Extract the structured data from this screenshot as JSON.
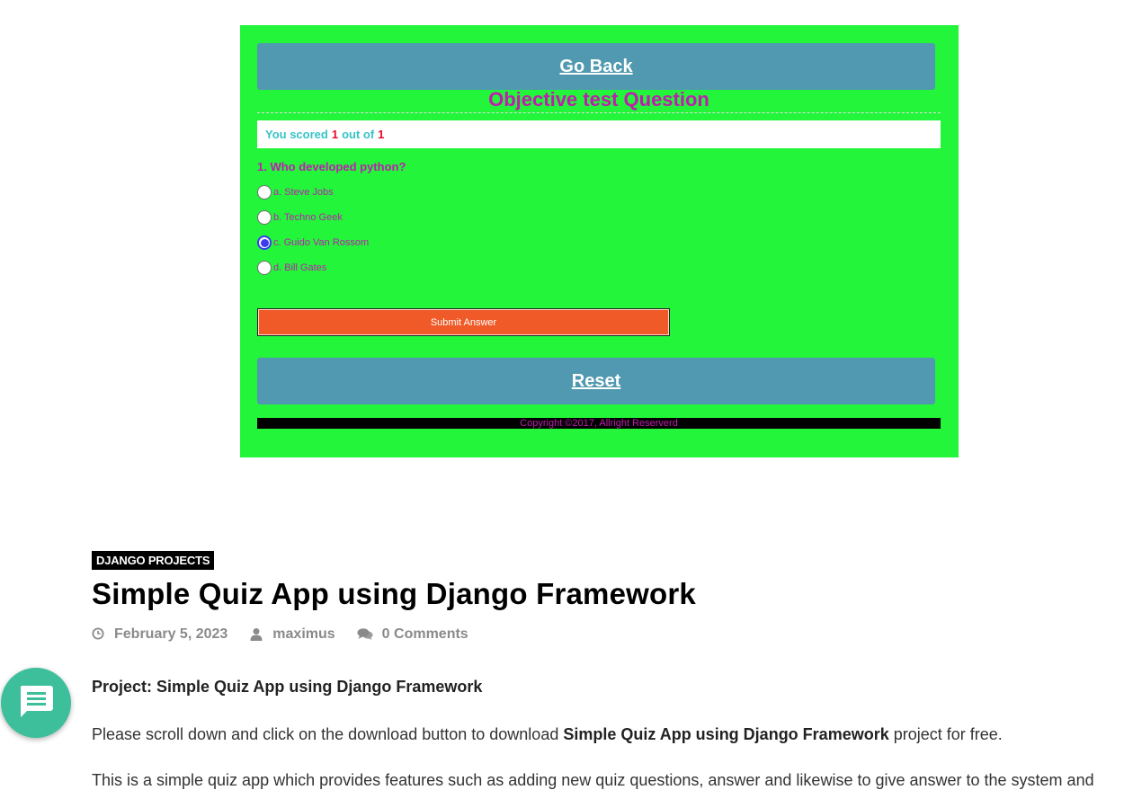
{
  "quiz": {
    "go_back_label": "Go Back",
    "title": "Objective test Question",
    "score": {
      "prefix": "You scored",
      "score": "1",
      "middle": "out of",
      "total": "1"
    },
    "question": "1. Who developed python?",
    "options": [
      {
        "label": "a. Steve Jobs",
        "selected": false
      },
      {
        "label": "b. Techno Geek",
        "selected": false
      },
      {
        "label": "c. Guido Van Rossom",
        "selected": true
      },
      {
        "label": "d. Bill Gates",
        "selected": false
      }
    ],
    "submit_label": "Submit Answer",
    "reset_label": "Reset",
    "footer": "Copyright ©2017, Allright Reserverd",
    "colors": {
      "background": "#22f53a",
      "button": "#5099b0",
      "title": "#c01cb0",
      "submit": "#ef5a28"
    }
  },
  "article": {
    "category": "DJANGO PROJECTS",
    "title": "Simple Quiz App using Django Framework",
    "meta": {
      "date": "February 5, 2023",
      "author": "maximus",
      "comments": "0 Comments"
    },
    "project_line": "Project: Simple Quiz App using Django Framework",
    "download": {
      "before": "Please scroll down and click on the download button to download ",
      "bold": "Simple Quiz App using Django Framework",
      "after": " project for free."
    },
    "cut_text": "This is a simple quiz app which provides features such as adding new quiz questions, answer and likewise to give answer to the system and"
  },
  "chat_button": {
    "icon": "chat-bubble-icon",
    "color": "#3dbf9c"
  }
}
